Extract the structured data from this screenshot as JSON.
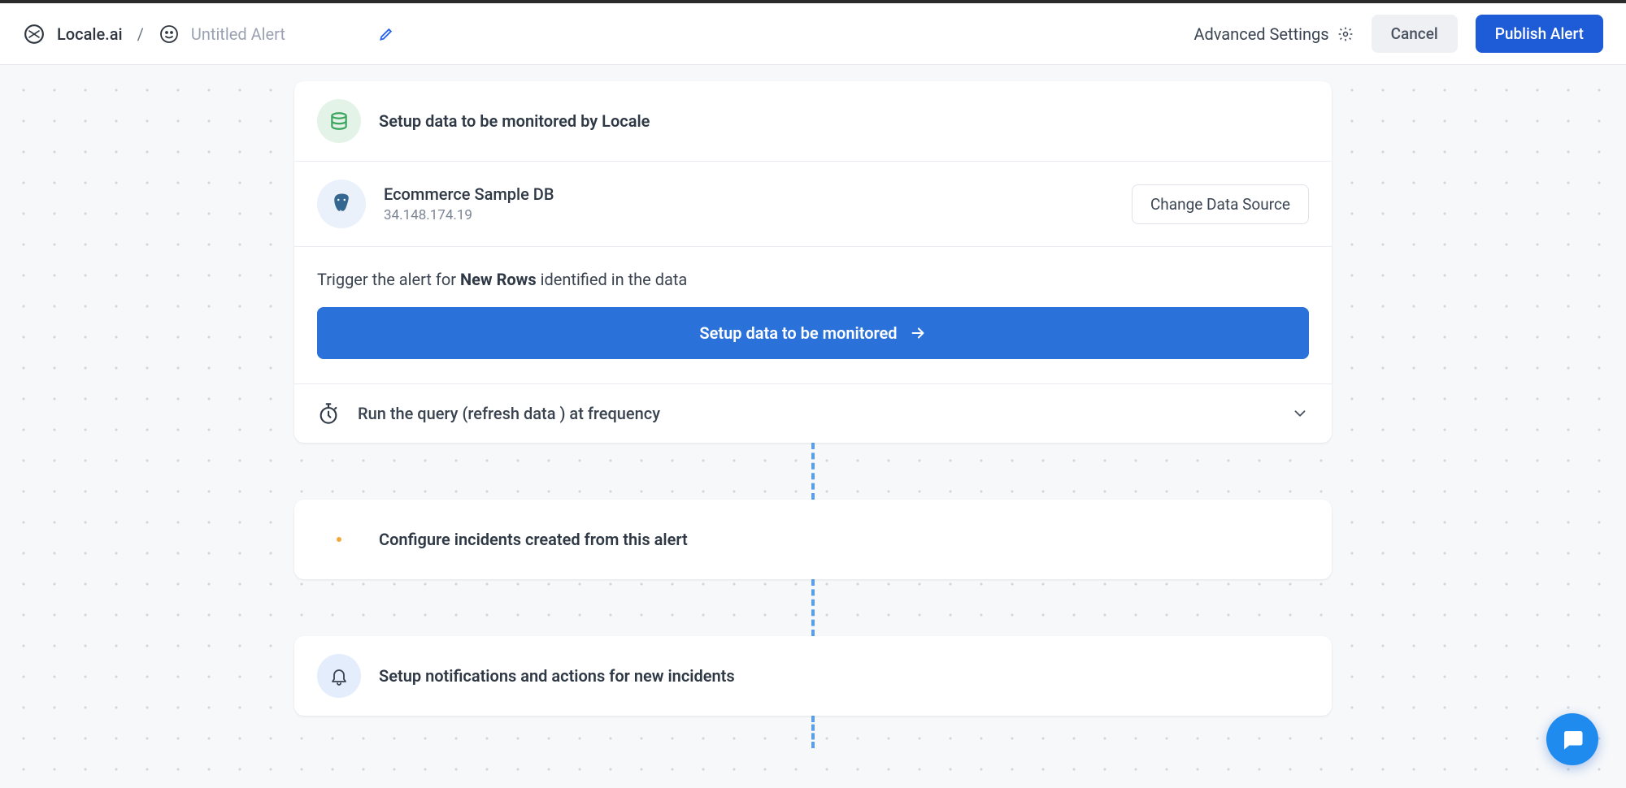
{
  "header": {
    "brand": "Locale.ai",
    "separator": "/",
    "alert_title": "Untitled Alert",
    "advanced_settings": "Advanced Settings",
    "cancel": "Cancel",
    "publish": "Publish Alert"
  },
  "step_data": {
    "title": "Setup data to be monitored by Locale",
    "datasource": {
      "name": "Ecommerce Sample DB",
      "host": "34.148.174.19",
      "change_btn": "Change Data Source"
    },
    "trigger_prefix": "Trigger the alert for ",
    "trigger_bold": "New Rows",
    "trigger_suffix": " identified in the data",
    "setup_btn": "Setup data to be monitored",
    "frequency_label": "Run the query (refresh data ) at frequency"
  },
  "step_incidents": {
    "title": "Configure incidents created from this alert"
  },
  "step_notifications": {
    "title": "Setup notifications and actions for new incidents"
  }
}
